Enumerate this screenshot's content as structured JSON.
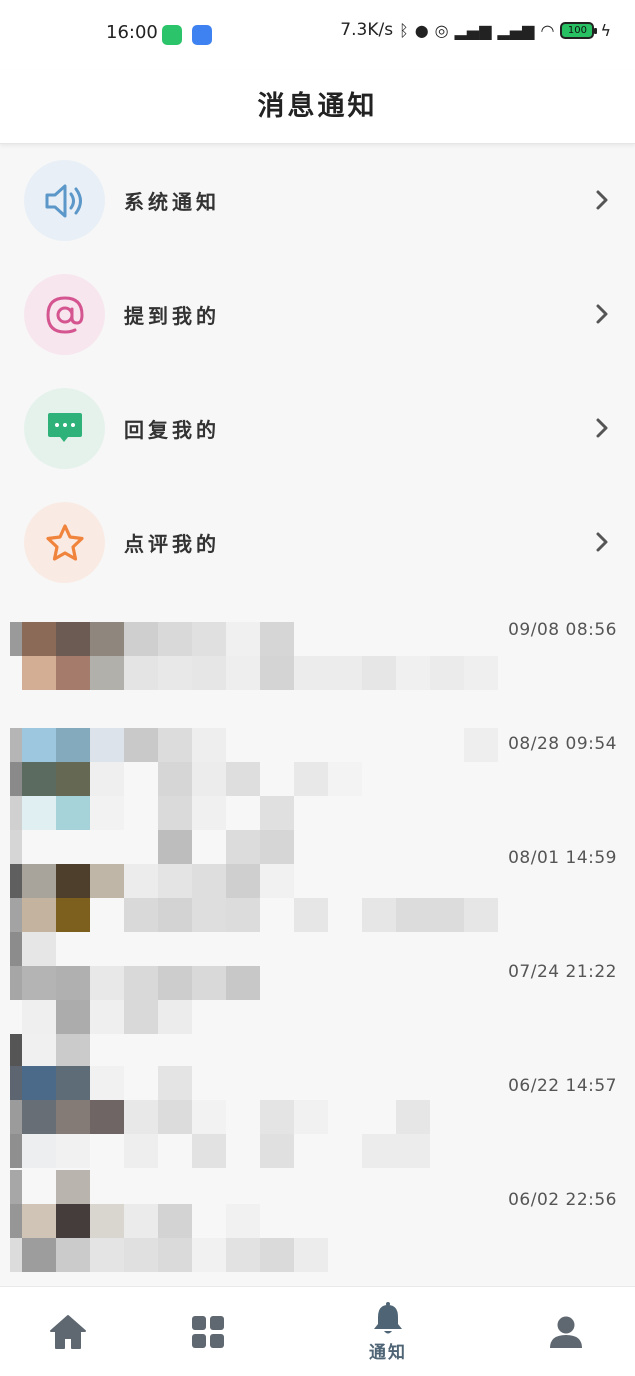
{
  "status_bar": {
    "time": "16:00",
    "net_speed": "7.3K/s",
    "battery": "100",
    "icons": [
      "wechat-icon",
      "game-icon",
      "bluetooth-icon",
      "ghost-icon",
      "alarm-icon",
      "signal-hd-icon",
      "signal-hd-icon",
      "wifi-icon",
      "battery-icon",
      "charging-icon"
    ]
  },
  "header": {
    "title": "消息通知"
  },
  "categories": [
    {
      "label": "系统通知",
      "icon": "speaker-icon",
      "bg": "#e8eff6",
      "color": "#5b97c8"
    },
    {
      "label": "提到我的",
      "icon": "at-icon",
      "bg": "#f7e6ee",
      "color": "#d4558f"
    },
    {
      "label": "回复我的",
      "icon": "chat-bubble-icon",
      "bg": "#e5f2ec",
      "color": "#2fb17a"
    },
    {
      "label": "点评我的",
      "icon": "star-icon",
      "bg": "#f9ebe4",
      "color": "#f0843d"
    }
  ],
  "messages": [
    {
      "time": "09/08 08:56"
    },
    {
      "time": "08/28 09:54"
    },
    {
      "time": "08/01 14:59"
    },
    {
      "time": "07/24 21:22"
    },
    {
      "time": "06/22 14:57"
    },
    {
      "time": "06/02 22:56"
    }
  ],
  "tab_bar": {
    "tabs": [
      {
        "name": "home",
        "icon": "home-icon",
        "label": ""
      },
      {
        "name": "grid",
        "icon": "grid-icon",
        "label": ""
      },
      {
        "name": "notify",
        "icon": "bell-icon",
        "label": "通知",
        "active": true
      },
      {
        "name": "profile",
        "icon": "user-icon",
        "label": ""
      }
    ]
  },
  "colors": {
    "accent": "#4f6575",
    "background": "#f7f7f7"
  }
}
